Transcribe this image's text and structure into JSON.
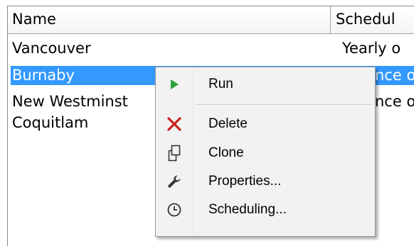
{
  "columns": {
    "name": "Name",
    "schedule": "Schedul"
  },
  "rows": [
    {
      "name": "Vancouver",
      "schedule": "Yearly o"
    },
    {
      "name": "Burnaby",
      "schedule": "nce or"
    },
    {
      "name": "New Westminst",
      "schedule": "nce or"
    },
    {
      "name": "Coquitlam",
      "schedule": ""
    }
  ],
  "context_menu": {
    "items": [
      {
        "label": "Run",
        "icon": "run-icon"
      },
      {
        "label": "Delete",
        "icon": "delete-icon"
      },
      {
        "label": "Clone",
        "icon": "clone-icon"
      },
      {
        "label": "Properties...",
        "icon": "wrench-icon"
      },
      {
        "label": "Scheduling...",
        "icon": "clock-icon"
      }
    ]
  },
  "colors": {
    "selection": "#3399ff",
    "run_icon": "#2aa33a",
    "delete_icon": "#c8221e"
  }
}
